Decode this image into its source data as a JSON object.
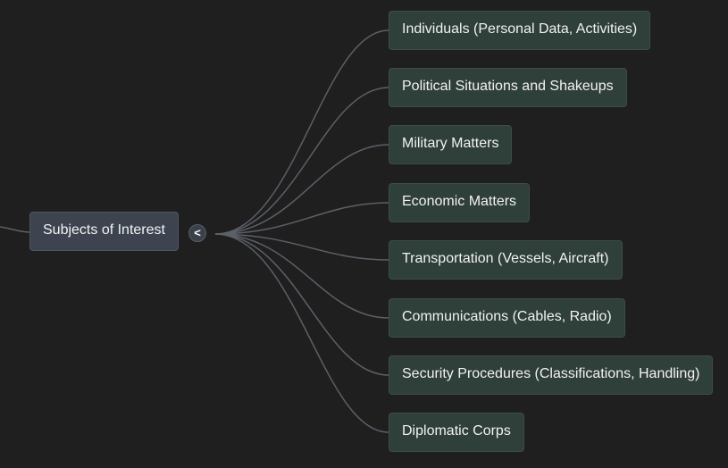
{
  "mindmap": {
    "root": {
      "label": "Subjects of Interest"
    },
    "toggle": {
      "glyph": "<",
      "icon": "collapse-chevron-left-icon"
    },
    "children": [
      {
        "label": "Individuals (Personal Data, Activities)"
      },
      {
        "label": "Political Situations and Shakeups"
      },
      {
        "label": "Military Matters"
      },
      {
        "label": "Economic Matters"
      },
      {
        "label": "Transportation (Vessels, Aircraft)"
      },
      {
        "label": "Communications (Cables, Radio)"
      },
      {
        "label": "Security Procedures (Classifications, Handling)"
      },
      {
        "label": "Diplomatic Corps"
      }
    ],
    "colors": {
      "background": "#1f1f1f",
      "root_fill": "#3d4450",
      "child_fill": "#2f3f3a",
      "edge": "#5c6068",
      "text": "#f2f2f2"
    }
  }
}
